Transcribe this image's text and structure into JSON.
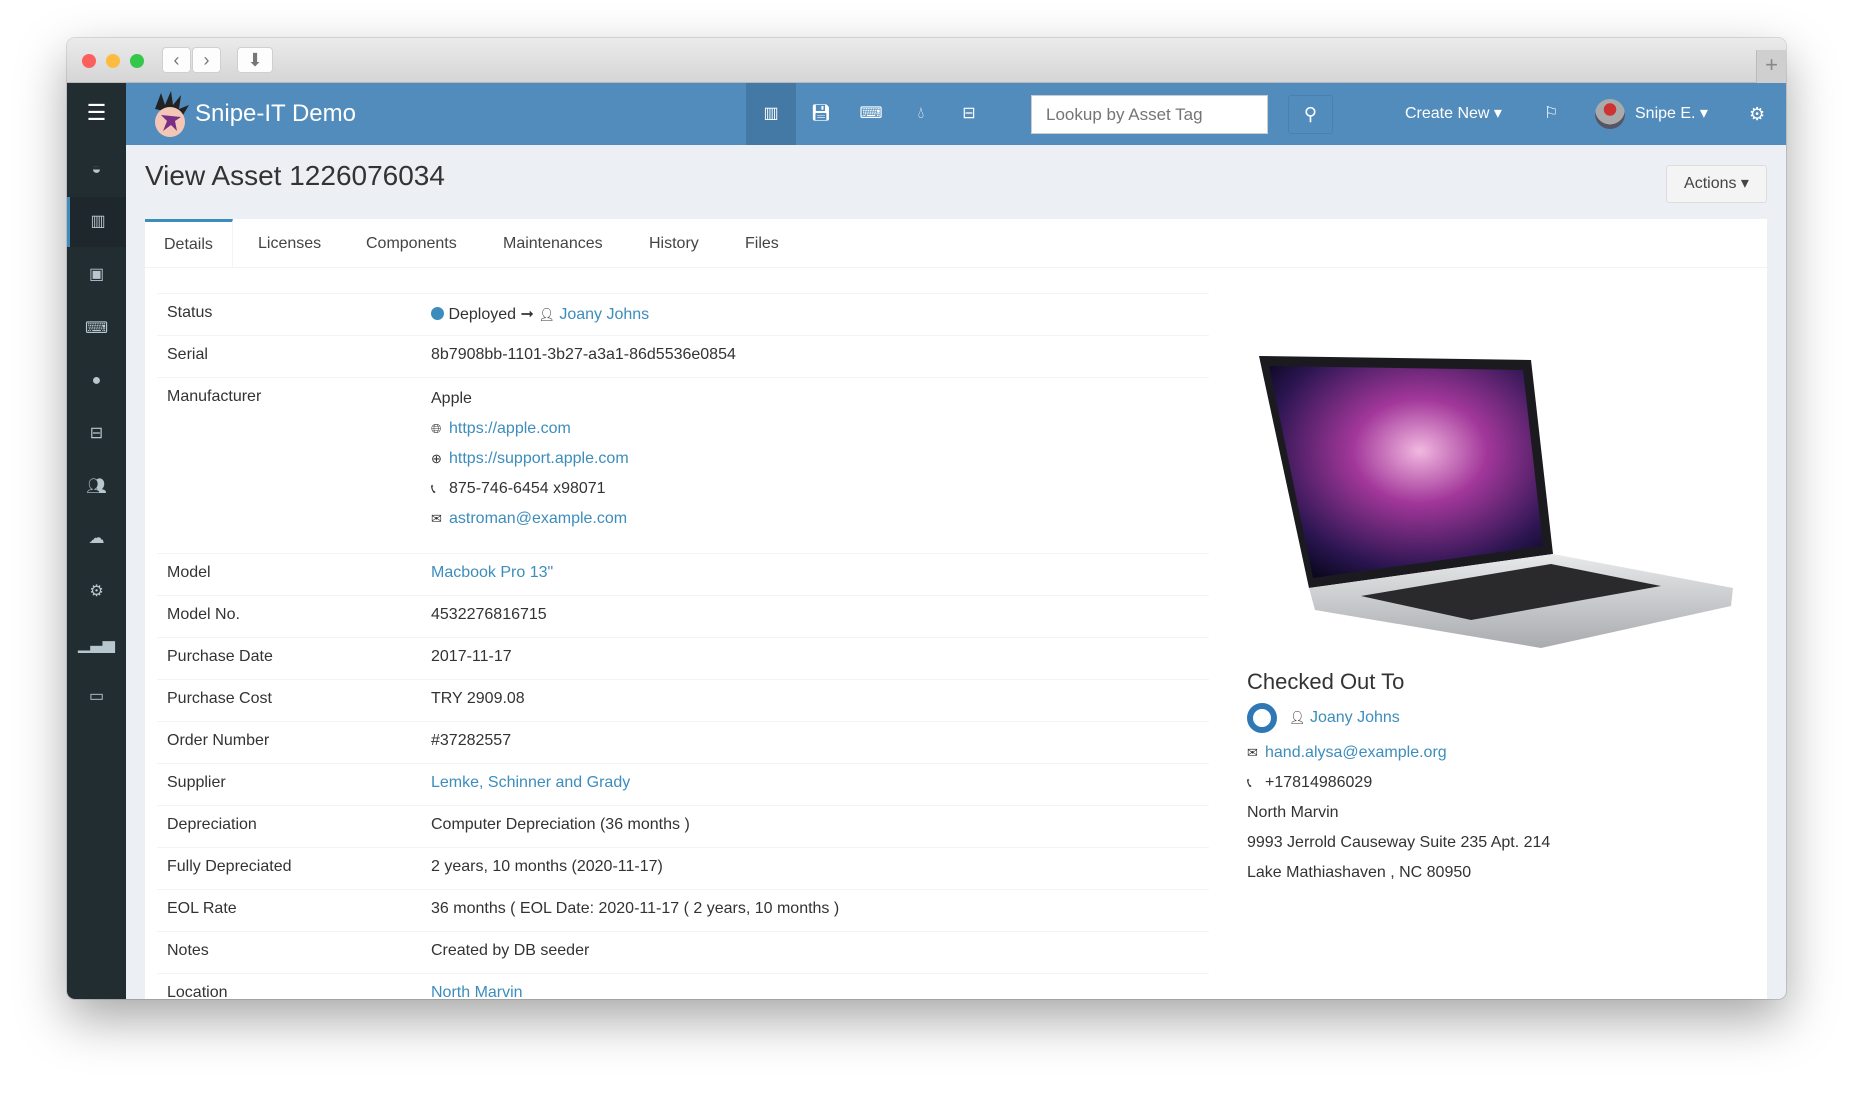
{
  "app": {
    "title": "Snipe-IT Demo"
  },
  "header": {
    "search_placeholder": "Lookup by Asset Tag",
    "create_new": "Create New",
    "user": "Snipe E.",
    "icons": [
      "barcode-icon",
      "floppy-icon",
      "keyboard-icon",
      "tint-icon",
      "hdd-icon"
    ]
  },
  "sidebar": {
    "items": [
      "dashboard-icon",
      "barcode-icon",
      "floppy-icon",
      "keyboard-icon",
      "tint-icon",
      "hdd-icon",
      "users-icon",
      "cloud-download-icon",
      "cog-icon",
      "bar-chart-icon",
      "laptop-icon"
    ],
    "active": 1
  },
  "page": {
    "title": "View Asset 1226076034",
    "actions": "Actions"
  },
  "tabs": [
    "Details",
    "Licenses",
    "Components",
    "Maintenances",
    "History",
    "Files"
  ],
  "details": {
    "status_label": "Status",
    "status_value": "Deployed",
    "status_user": "Joany Johns",
    "status_color": "#3c8dbc",
    "serial_label": "Serial",
    "serial": "8b7908bb-1101-3b27-a3a1-86d5536e0854",
    "manufacturer_label": "Manufacturer",
    "manufacturer": "Apple",
    "manufacturer_url": "https://apple.com",
    "support_url": "https://support.apple.com",
    "manufacturer_phone": "875-746-6454 x98071",
    "manufacturer_email": "astroman@example.com",
    "rows": [
      {
        "label": "Model",
        "value": "Macbook Pro 13\"",
        "link": true
      },
      {
        "label": "Model No.",
        "value": "4532276816715"
      },
      {
        "label": "Purchase Date",
        "value": "2017-11-17"
      },
      {
        "label": "Purchase Cost",
        "value": "TRY 2909.08"
      },
      {
        "label": "Order Number",
        "value": "#37282557"
      },
      {
        "label": "Supplier",
        "value": "Lemke, Schinner and Grady",
        "link": true
      },
      {
        "label": "Depreciation",
        "value": "Computer Depreciation (36 months )"
      },
      {
        "label": "Fully Depreciated",
        "value": "2 years, 10 months (2020-11-17)"
      },
      {
        "label": "EOL Rate",
        "value": "36 months ( EOL Date: 2020-11-17 ( 2 years, 10 months )"
      },
      {
        "label": "Notes",
        "value": "Created by DB seeder"
      },
      {
        "label": "Location",
        "value": "North Marvin",
        "link": true
      }
    ]
  },
  "checked_out": {
    "heading": "Checked Out To",
    "name": "Joany Johns",
    "email": "hand.alysa@example.org",
    "phone": "+17814986029",
    "city": "North Marvin",
    "address": "9993 Jerrold Causeway Suite 235 Apt. 214",
    "region": "Lake Mathiashaven , NC 80950"
  }
}
